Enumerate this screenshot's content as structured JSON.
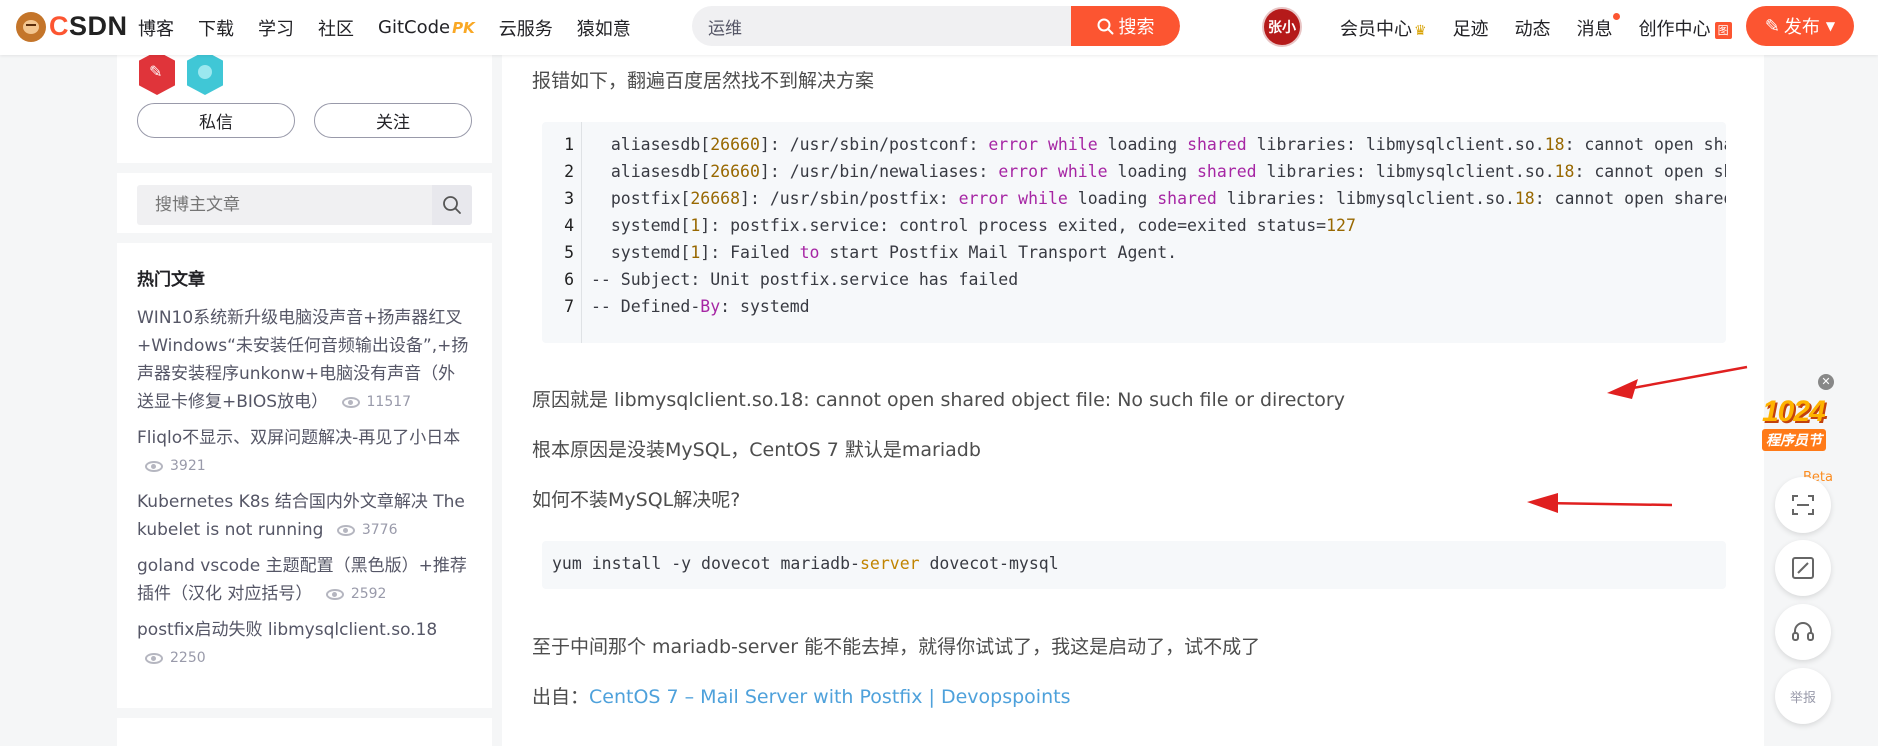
{
  "header": {
    "logo_text_c": "C",
    "logo_text_sdn": "SDN",
    "nav": [
      "博客",
      "下载",
      "学习",
      "社区",
      "GitCode",
      "云服务",
      "猿如意"
    ],
    "gitcode_badge": "PK",
    "search_value": "运维",
    "search_button": "搜索",
    "avatar_text": "张小",
    "links": {
      "member": "会员中心",
      "footprint": "足迹",
      "dynamic": "动态",
      "message": "消息",
      "creation": "创作中心",
      "creation_badge": "图"
    },
    "publish": "发布",
    "accent_color": "#fc5531"
  },
  "sidebar": {
    "btn_message": "私信",
    "btn_follow": "关注",
    "search_placeholder": "搜博主文章",
    "hot_title": "热门文章",
    "hot_articles": [
      {
        "title": "WIN10系统新升级电脑没声音+扬声器红叉+Windows“未安装任何音频输出设备”,+扬声器安装程序unkonw+电脑没有声音（外送显卡修复+BIOS放电）",
        "views": "11517"
      },
      {
        "title": "Fliqlo不显示、双屏问题解决-再见了小日本",
        "views": "3921"
      },
      {
        "title": "Kubernetes K8s 结合国内外文章解决 The kubelet is not running",
        "views": "3776"
      },
      {
        "title": "goland vscode 主题配置（黑色版）+推荐插件（汉化 对应括号）",
        "views": "2592"
      },
      {
        "title": "postfix启动失败 libmysqlclient.so.18",
        "views": "2250"
      }
    ]
  },
  "article": {
    "intro": "报错如下，翻遍百度居然找不到解决方案",
    "code_line_numbers": [
      "1",
      "2",
      "3",
      "4",
      "5",
      "6",
      "7"
    ],
    "cause": "原因就是 libmysqlclient.so.18: cannot open shared object file: No such file or directory",
    "root_cause": "根本原因是没装MySQL，CentOS 7 默认是mariadb",
    "question": "如何不装MySQL解决呢?",
    "install_cmd_before": "yum install -y dovecot mariadb-",
    "install_cmd_keyword": "server",
    "install_cmd_after": " dovecot-mysql",
    "note": "至于中间那个 mariadb-server 能不能去掉，就得你试试了，我这是启动了，试不成了",
    "source_label": "出自：",
    "source_link": "CentOS 7 – Mail Server with Postfix | Devopspoints",
    "annotation_color": "#e02020"
  },
  "right_tools": {
    "promo_main": "1024",
    "promo_sub": "程序员节",
    "beta": "Beta",
    "report": "举报"
  }
}
